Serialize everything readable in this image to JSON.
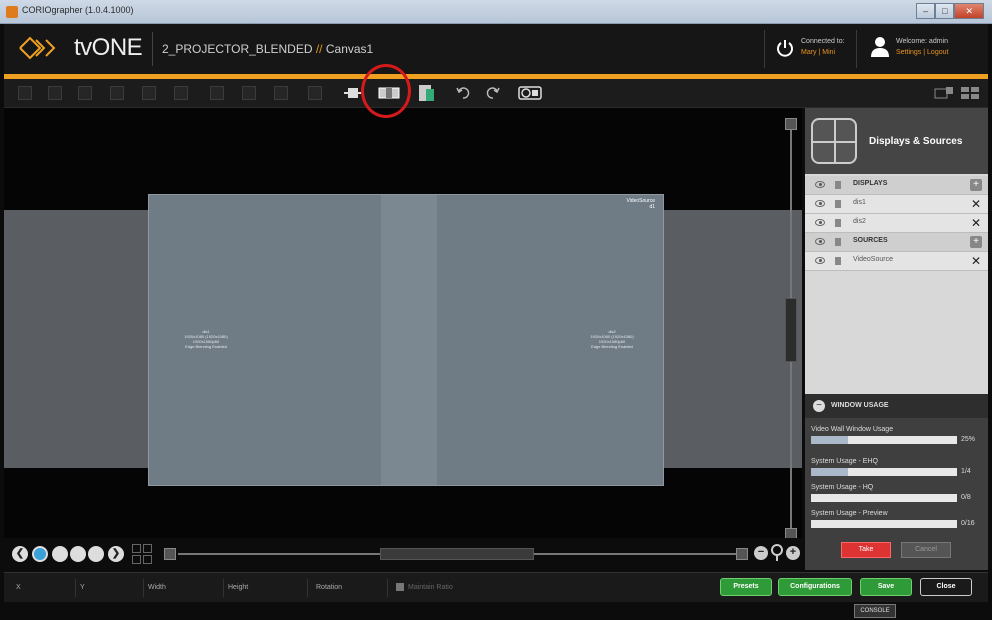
{
  "window": {
    "title": "CORIOgrapher (1.0.4.1000)",
    "controls": [
      "–",
      "□",
      "✕"
    ]
  },
  "header": {
    "logo_text": "tvONE",
    "project": "2_PROJECTOR_BLENDED",
    "project_separator": "//",
    "canvas": "Canvas1",
    "connected_label": "Connected to:",
    "connected_value": "Mary | Mini",
    "welcome": "Welcome: admin",
    "settings_link": "Settings",
    "link_separator": "|",
    "logout_link": "Logout",
    "accent_color": "#f0a020"
  },
  "toolbar": {
    "align_icons": [
      "align-left-icon",
      "align-center-icon",
      "align-right-icon",
      "align-top-icon",
      "align-middle-icon",
      "align-bottom-icon",
      "distribute-h-icon",
      "distribute-v-icon",
      "center-icon",
      "fit-icon"
    ],
    "active_icons": [
      "crop-icon",
      "blend-icon",
      "layers-icon",
      "undo-icon",
      "redo-icon",
      "preview-icon"
    ],
    "right_icons": [
      "view-icon",
      "layout-icon"
    ]
  },
  "canvas": {
    "video_source_label": "VideoSource",
    "video_source_sub": "d1",
    "displays": [
      {
        "name": "dis1",
        "line1": "1920x1080 (1920x1080)",
        "line2": "1920x1080p60",
        "line3": "Edge Blending Enabled"
      },
      {
        "name": "dis2",
        "line1": "1920x1080 (1920x1080)",
        "line2": "1920x1080p60",
        "line3": "Edge Blending Enabled"
      }
    ]
  },
  "nav": {
    "prev": "❮",
    "next": "❯",
    "dots": 5,
    "active_dot": 0,
    "zoom_out": "−",
    "zoom_in": "+"
  },
  "panel": {
    "title": "Displays & Sources",
    "groups": [
      {
        "label": "DISPLAYS",
        "items": [
          "dis1",
          "dis2"
        ]
      },
      {
        "label": "SOURCES",
        "items": [
          "VideoSource"
        ]
      }
    ],
    "usage": {
      "title": "WINDOW USAGE",
      "items": [
        {
          "label": "Video Wall Window Usage",
          "value": "25%",
          "fraction": 0.25
        },
        {
          "label": "System Usage - EHQ",
          "value": "1/4",
          "fraction": 0.25
        },
        {
          "label": "System Usage - HQ",
          "value": "0/8",
          "fraction": 0.0
        },
        {
          "label": "System Usage - Preview",
          "value": "0/16",
          "fraction": 0.0
        }
      ],
      "take": "Take",
      "cancel": "Cancel"
    }
  },
  "bottom": {
    "x_label": "X",
    "y_label": "Y",
    "width_label": "Width",
    "height_label": "Height",
    "rotation_label": "Rotation",
    "maintain_ratio": "Maintain Ratio",
    "presets": "Presets",
    "configurations": "Configurations",
    "save": "Save",
    "close": "Close",
    "console": "CONSOLE"
  }
}
